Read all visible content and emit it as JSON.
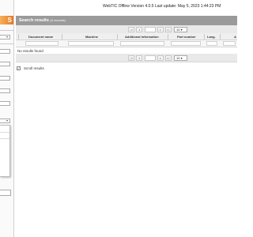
{
  "header": {
    "title": "WebTIC Offline Version 4.0.5 Last update: May 5, 2023 1:44:23 PM"
  },
  "sidebar": {
    "logo_text": "S"
  },
  "results": {
    "title": "Search results",
    "count": "(0 records)",
    "no_results": "No results found",
    "page_size": "10"
  },
  "columns": {
    "document_name": "Document name",
    "machine": "Machine",
    "additional_information": "Additional information",
    "part_number": "Part number",
    "language": "Lang.",
    "extra": "A"
  },
  "options": {
    "scroll_results_label": "Scroll results",
    "scroll_results_checked": "✓"
  },
  "colors": {
    "results_bar": "#9a9a9a",
    "logo_accent": "#e87722"
  }
}
